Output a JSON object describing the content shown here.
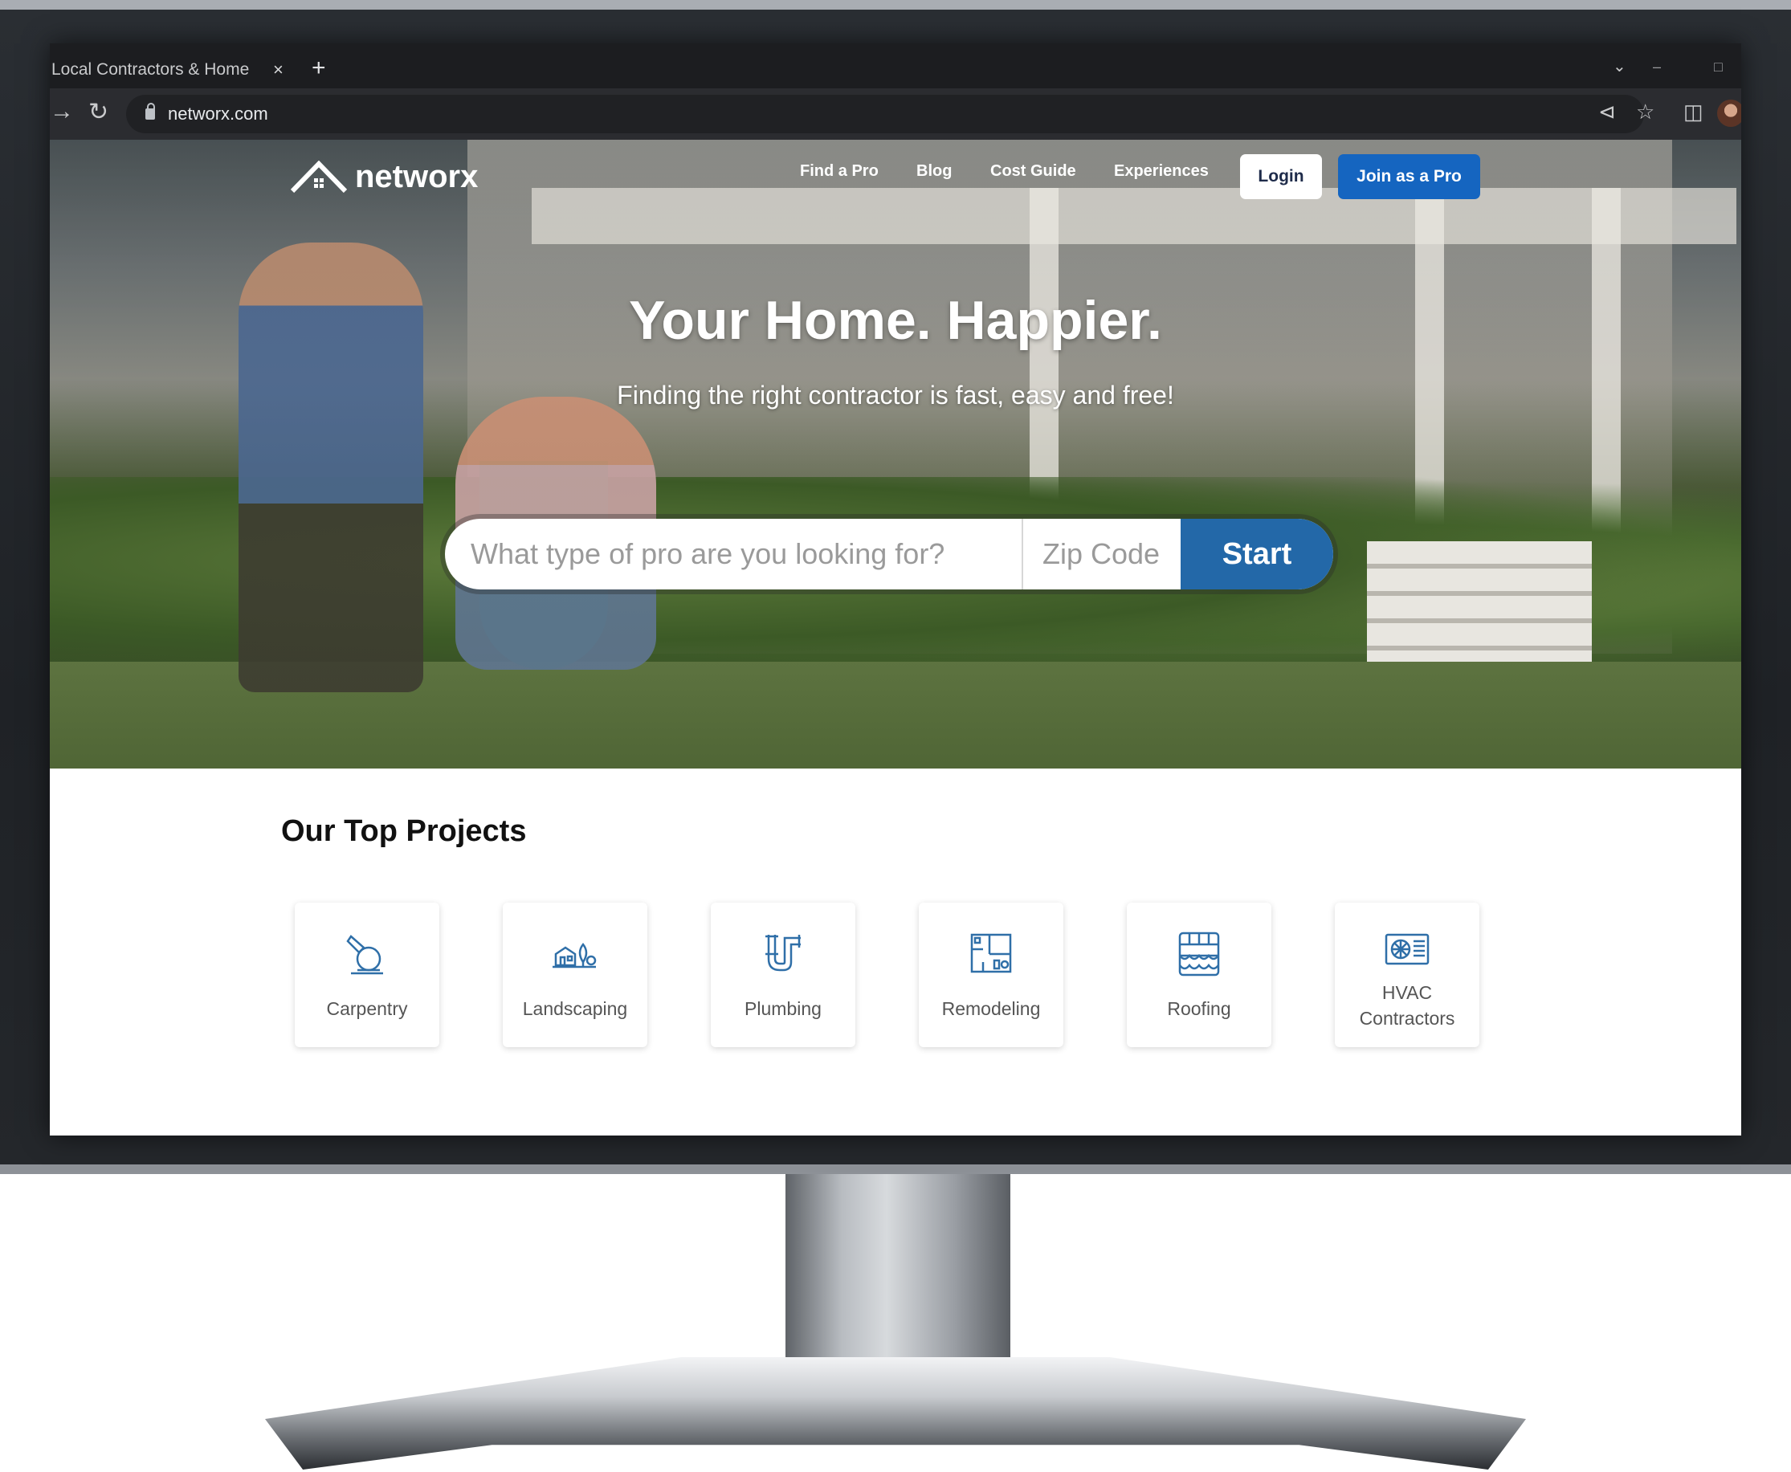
{
  "browser": {
    "tab_title": "Local Contractors & Home",
    "tab_close": "×",
    "new_tab": "+",
    "url": "networx.com"
  },
  "site": {
    "logo_text": "networx",
    "nav": [
      "Find a Pro",
      "Blog",
      "Cost Guide",
      "Experiences"
    ],
    "login_label": "Login",
    "join_label": "Join as a Pro"
  },
  "hero": {
    "title": "Your Home. Happier.",
    "subtitle": "Finding the right contractor is fast, easy and free!",
    "search_placeholder": "What type of pro are you looking for?",
    "zip_placeholder": "Zip Code",
    "start_label": "Start"
  },
  "projects": {
    "title": "Our Top Projects",
    "items": [
      {
        "label": "Carpentry",
        "icon": "circular-saw-icon"
      },
      {
        "label": "Landscaping",
        "icon": "landscape-house-icon"
      },
      {
        "label": "Plumbing",
        "icon": "pipe-icon"
      },
      {
        "label": "Remodeling",
        "icon": "floor-plan-icon"
      },
      {
        "label": "Roofing",
        "icon": "roof-tiles-icon"
      },
      {
        "label": "HVAC Contractors",
        "icon": "hvac-unit-icon"
      }
    ]
  },
  "colors": {
    "brand_blue": "#1565c0",
    "start_blue": "#2368a8",
    "icon_blue": "#2f6fa8"
  }
}
